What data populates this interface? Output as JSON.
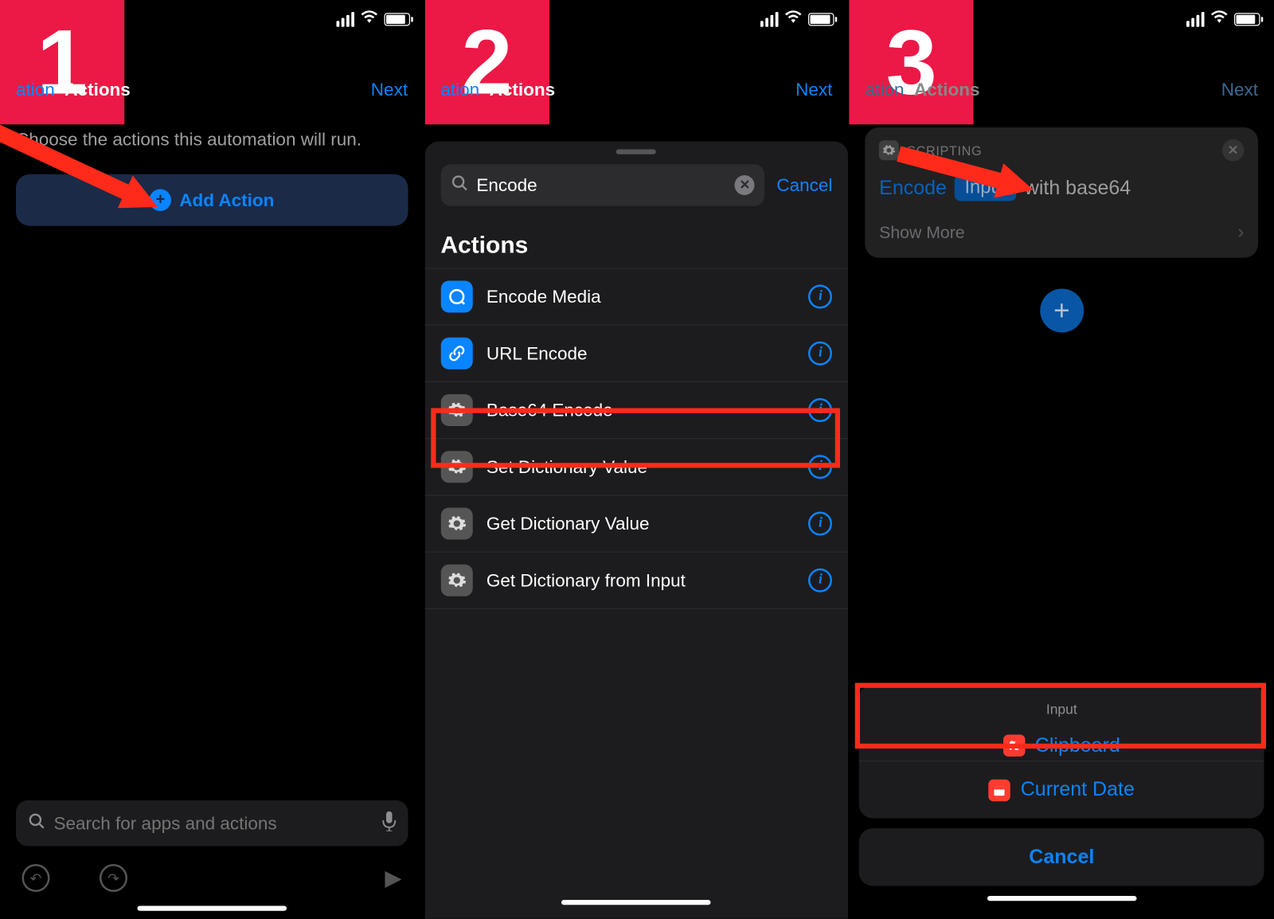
{
  "steps": [
    "1",
    "2",
    "3"
  ],
  "nav": {
    "back_partial": "ation",
    "title": "Actions",
    "next": "Next"
  },
  "panel1": {
    "desc": "Choose the actions this automation will run.",
    "add_action": "Add Action",
    "search_placeholder": "Search for apps and actions"
  },
  "panel2": {
    "search_value": "Encode",
    "cancel": "Cancel",
    "section_title": "Actions",
    "rows": [
      {
        "label": "Encode Media",
        "icon": "quicktime"
      },
      {
        "label": "URL Encode",
        "icon": "link"
      },
      {
        "label": "Base64 Encode",
        "icon": "gear"
      },
      {
        "label": "Set Dictionary Value",
        "icon": "gear"
      },
      {
        "label": "Get Dictionary Value",
        "icon": "gear"
      },
      {
        "label": "Get Dictionary from Input",
        "icon": "gear"
      }
    ]
  },
  "panel3": {
    "category": "SCRIPTING",
    "encode": "Encode",
    "input_token": "Input",
    "with_base64": "with base64",
    "show_more": "Show More",
    "picker_title": "Input",
    "clipboard": "Clipboard",
    "current_date": "Current Date",
    "cancel": "Cancel"
  }
}
